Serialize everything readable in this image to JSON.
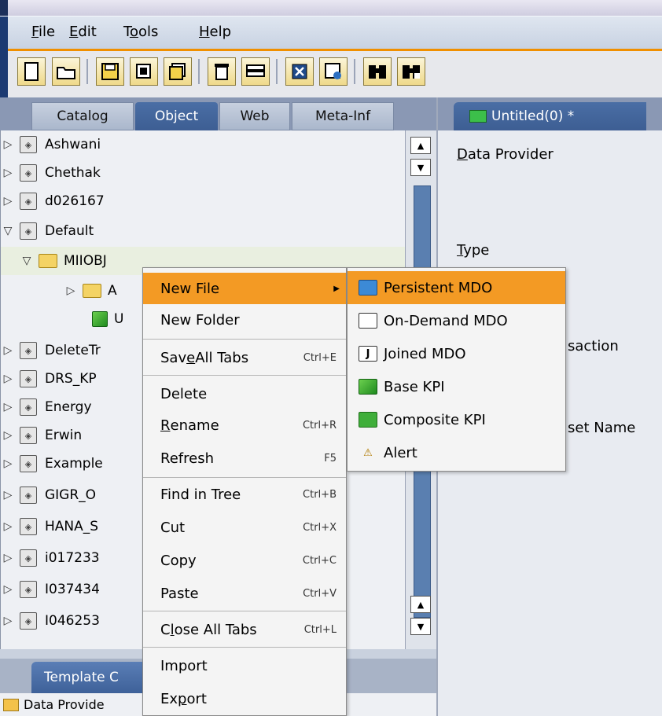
{
  "menu": {
    "file": {
      "first": "F",
      "rest": "ile"
    },
    "edit": {
      "first": "E",
      "rest": "dit"
    },
    "tools": {
      "pre": "T",
      "u": "o",
      "post": "ols"
    },
    "help": {
      "first": "H",
      "rest": "elp"
    }
  },
  "left_tabs": [
    "Catalog",
    "Object",
    "Web",
    "Meta-Inf"
  ],
  "tree": [
    {
      "label": "Ashwani",
      "caret": "▷"
    },
    {
      "label": "Chethak",
      "caret": "▷"
    },
    {
      "label": "d026167",
      "caret": "▷"
    },
    {
      "label": "Default",
      "caret": "▽"
    },
    {
      "label": "MIIOBJ",
      "caret": "▽"
    },
    {
      "label": "A",
      "caret": "▷"
    },
    {
      "label": "U",
      "caret": ""
    },
    {
      "label": "DeleteTr",
      "caret": "▷"
    },
    {
      "label": "DRS_KP",
      "caret": "▷"
    },
    {
      "label": "Energy",
      "caret": "▷"
    },
    {
      "label": "Erwin",
      "caret": "▷"
    },
    {
      "label": "Example",
      "caret": "▷"
    },
    {
      "label": "GIGR_O",
      "caret": "▷"
    },
    {
      "label": "HANA_S",
      "caret": "▷"
    },
    {
      "label": "i017233",
      "caret": "▷"
    },
    {
      "label": "I037434",
      "caret": "▷"
    },
    {
      "label": "I046253",
      "caret": "▷"
    }
  ],
  "bottom": {
    "tab": "Template C",
    "row": "Data Provide"
  },
  "right": {
    "tab": "Untitled(0) *",
    "data_provider": {
      "u": "D",
      "rest": "ata Provider"
    },
    "type": {
      "u": "T",
      "rest": "ype"
    },
    "transaction": "saction",
    "dataset": "set Name"
  },
  "context_menu": {
    "new_file": "New File",
    "new_folder": "New Folder",
    "save_all": {
      "pre": "Sav",
      "u": "e",
      "post": " All Tabs",
      "sc": "Ctrl+E"
    },
    "delete": "Delete",
    "rename": {
      "u": "R",
      "rest": "ename",
      "sc": "Ctrl+R"
    },
    "refresh": {
      "label": "Refresh",
      "sc": "F5"
    },
    "find": {
      "label": "Find in Tree",
      "sc": "Ctrl+B"
    },
    "cut": {
      "label": "Cut",
      "sc": "Ctrl+X"
    },
    "copy": {
      "label": "Copy",
      "sc": "Ctrl+C"
    },
    "paste": {
      "label": "Paste",
      "sc": "Ctrl+V"
    },
    "close_all": {
      "pre": "C",
      "u": "l",
      "post": "ose All Tabs",
      "sc": "Ctrl+L"
    },
    "import": "Import",
    "export": {
      "pre": "Ex",
      "u": "p",
      "post": "ort"
    }
  },
  "submenu": {
    "persistent": "Persistent MDO",
    "on_demand": "On-Demand MDO",
    "joined": "Joined MDO",
    "base_kpi": "Base KPI",
    "composite_kpi": "Composite KPI",
    "alert": "Alert"
  },
  "colors": {
    "highlight": "#f39a24",
    "toolbar_accent": "#f08f00",
    "nav_blue": "#3d5e93"
  }
}
